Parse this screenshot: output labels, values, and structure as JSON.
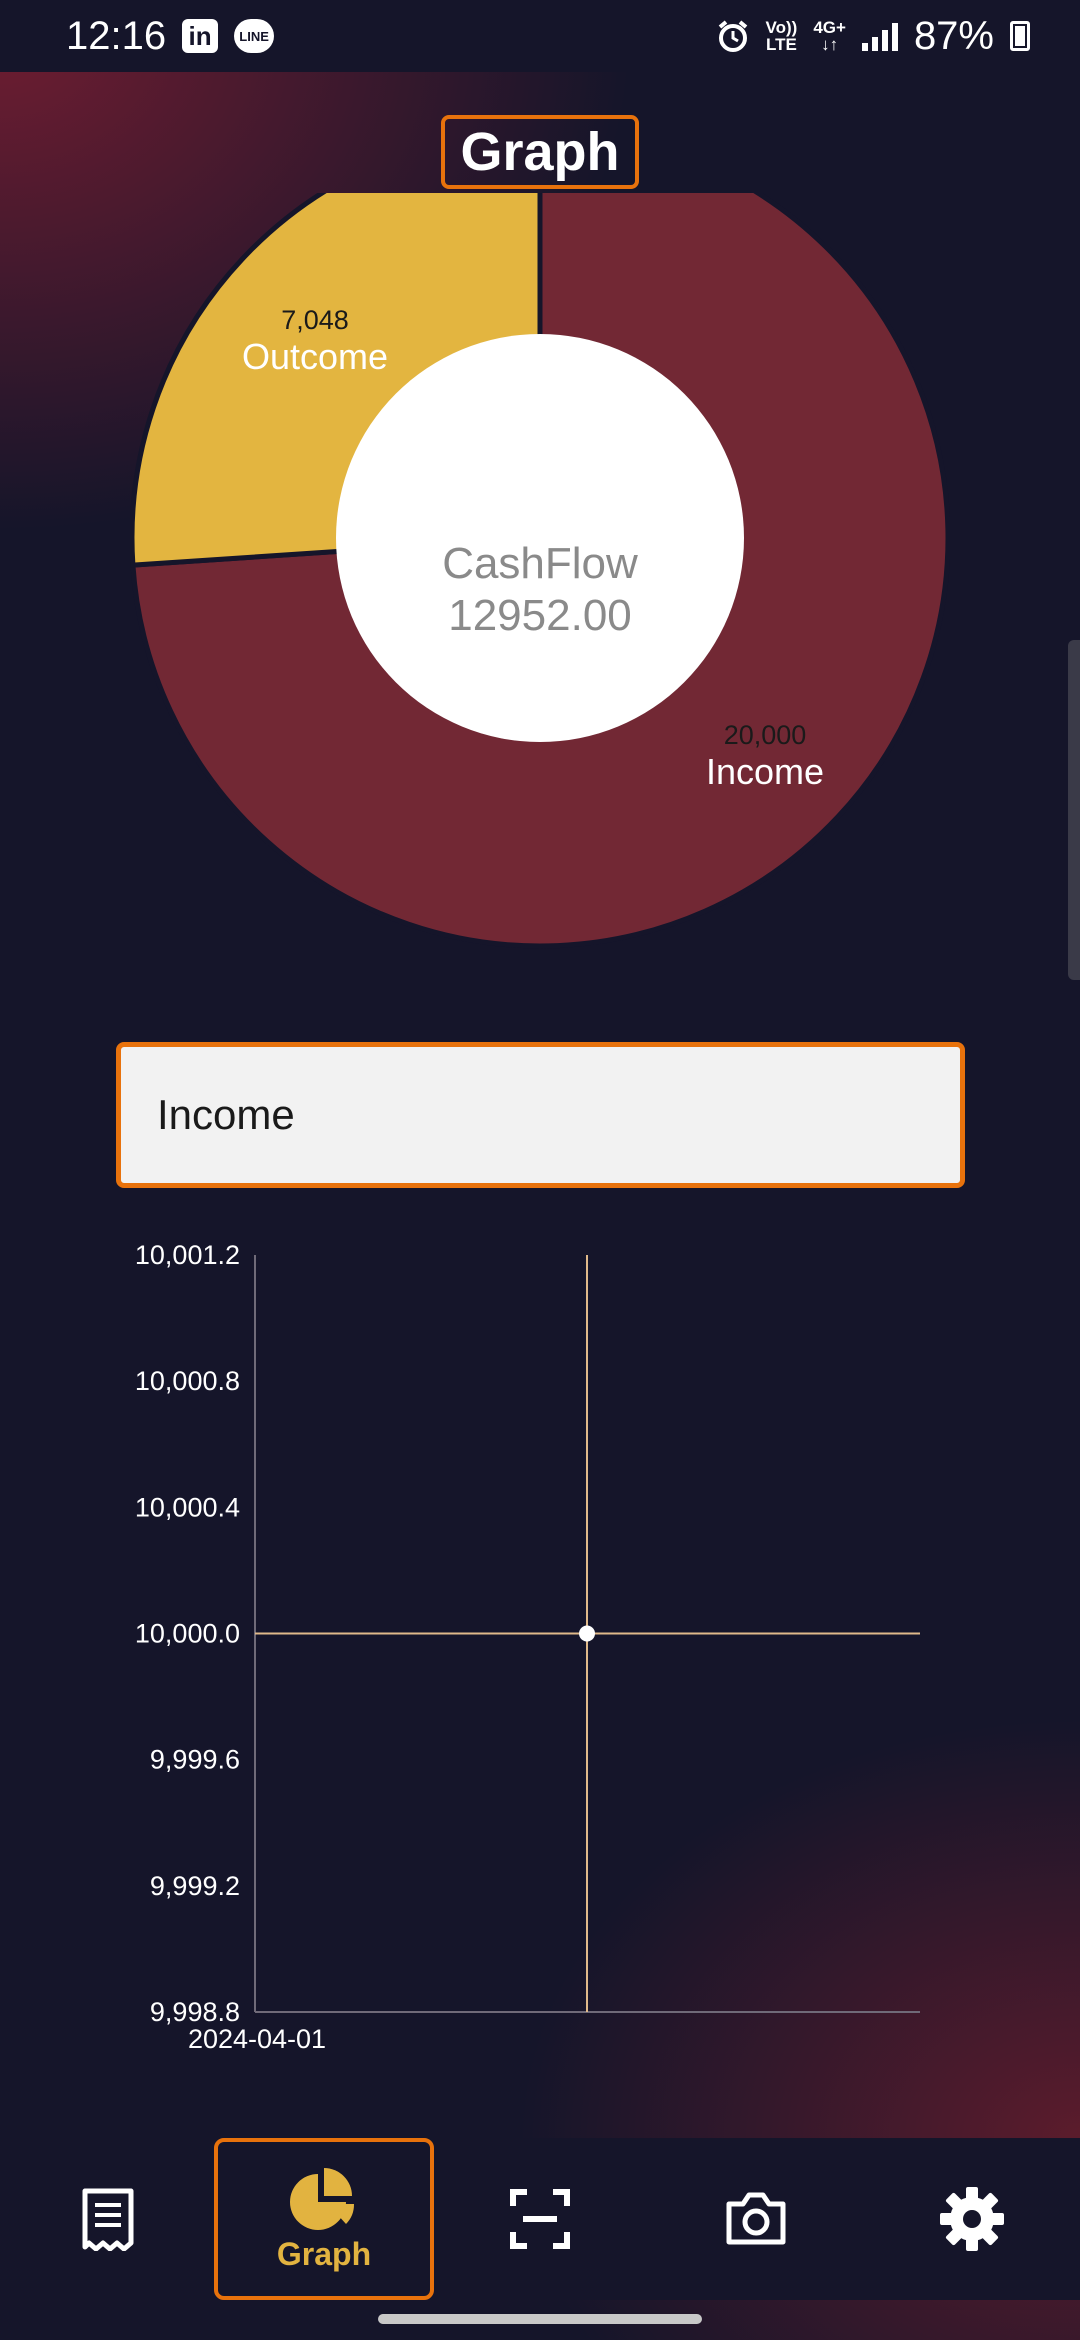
{
  "status_bar": {
    "time": "12:16",
    "network_top": "Vo))",
    "network_bottom": "LTE",
    "data_top": "4G+",
    "data_bottom": "↓↑",
    "battery_percent": "87%",
    "icons": [
      "linkedin-icon",
      "line-icon",
      "alarm-icon",
      "signal-icon",
      "battery-icon"
    ]
  },
  "header": {
    "title": "Graph"
  },
  "cashflow": {
    "label": "CashFlow",
    "value": "12952.00"
  },
  "dropdown": {
    "selected": "Income"
  },
  "colors": {
    "background": "#15152a",
    "accent_border": "#e8720c",
    "income": "#722834",
    "outcome": "#e3b540",
    "nav_active": "#e2b340",
    "chart_line": "#e0b98a"
  },
  "chart_data": [
    {
      "type": "pie",
      "title": "",
      "center_label": "CashFlow 12952.00",
      "slices": [
        {
          "label": "Income",
          "value": 20000,
          "value_label": "20,000",
          "color": "#722834"
        },
        {
          "label": "Outcome",
          "value": 7048,
          "value_label": "7,048",
          "color": "#e3b540"
        }
      ]
    },
    {
      "type": "line",
      "title": "",
      "xlabel": "",
      "ylabel": "",
      "x": [
        "2024-04-01"
      ],
      "series": [
        {
          "values": [
            10000.0
          ]
        }
      ],
      "ylim": [
        9998.8,
        10001.2
      ],
      "yticks": [
        "10,001.2",
        "10,000.8",
        "10,000.4",
        "10,000.0",
        "9,999.6",
        "9,999.2",
        "9,998.8"
      ],
      "xticks": [
        "2024-04-01"
      ],
      "grid": false
    }
  ],
  "bottom_nav": {
    "items": [
      {
        "name": "receipts",
        "icon": "receipt-icon",
        "label": ""
      },
      {
        "name": "graph",
        "icon": "pie-chart-icon",
        "label": "Graph",
        "active": true
      },
      {
        "name": "scan",
        "icon": "scan-icon",
        "label": ""
      },
      {
        "name": "camera",
        "icon": "camera-icon",
        "label": ""
      },
      {
        "name": "settings",
        "icon": "gear-icon",
        "label": ""
      }
    ]
  }
}
